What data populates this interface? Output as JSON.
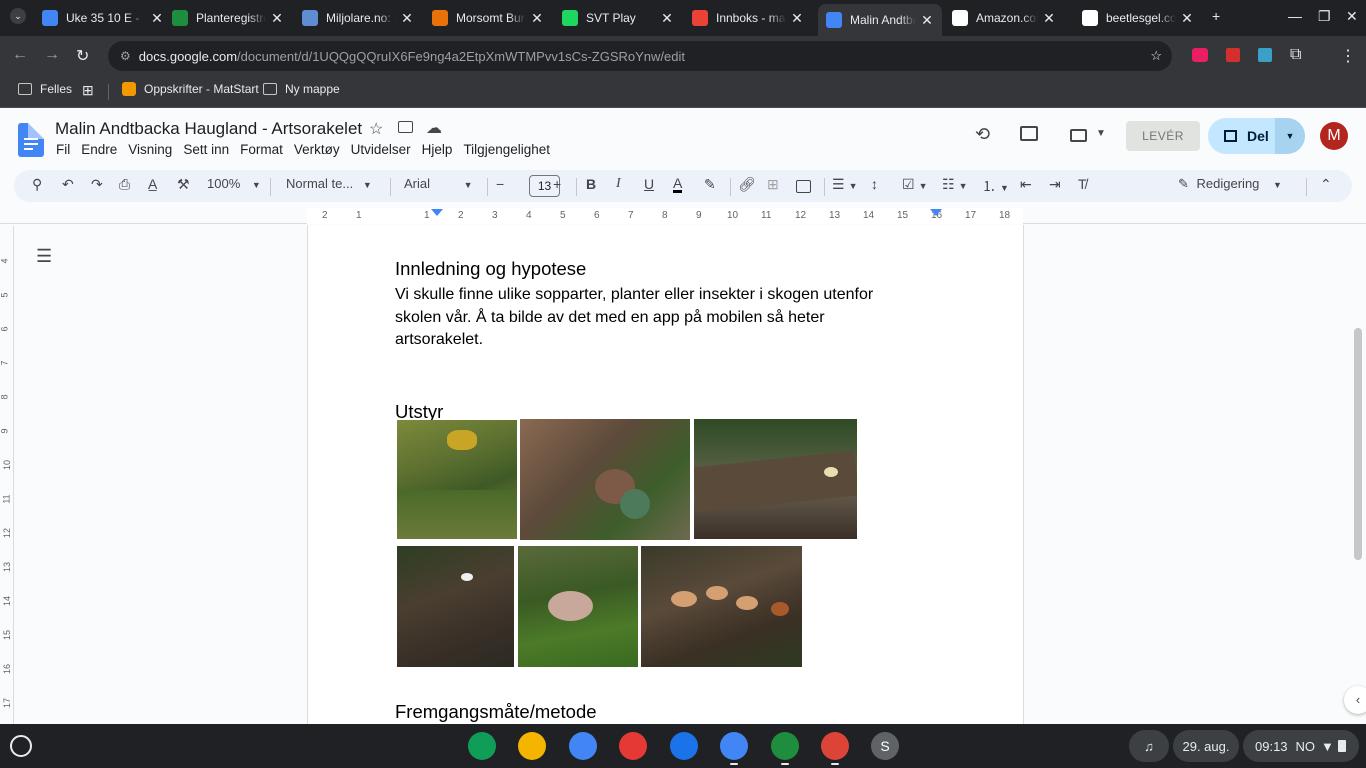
{
  "browser": {
    "tabs": [
      {
        "title": "Uke 35 10 E -",
        "icon": "docs-icon",
        "color": "#4285f4"
      },
      {
        "title": "Planteregistre",
        "icon": "classroom-icon",
        "color": "#1e8e3e"
      },
      {
        "title": "Miljolare.no: F",
        "icon": "globe-icon",
        "color": "#5f8dd3"
      },
      {
        "title": "Morsomt Bur",
        "icon": "site-icon",
        "color": "#e8710a"
      },
      {
        "title": "SVT Play",
        "icon": "play-icon",
        "color": "#1ed760"
      },
      {
        "title": "Innboks - mal",
        "icon": "gmail-icon",
        "color": "#ea4335"
      },
      {
        "title": "Malin Andtba",
        "icon": "docs-icon",
        "color": "#4285f4",
        "active": true
      },
      {
        "title": "Amazon.com",
        "icon": "amazon-icon",
        "color": "#ffffff"
      },
      {
        "title": "beetlesgel.co",
        "icon": "page-icon",
        "color": "#ffffff"
      }
    ],
    "url_domain": "docs.google.com",
    "url_path": "/document/d/1UQQgQQruIX6Fe9ng4a2EtpXmWTMPvv1sCs-ZGSRoYnw/edit",
    "bookmarks": [
      {
        "label": "Felles"
      },
      {
        "label": "Oppskrifter - MatStart"
      },
      {
        "label": "Ny mappe"
      }
    ]
  },
  "docs": {
    "title": "Malin Andtbacka Haugland - Artsorakelet",
    "menu": [
      "Fil",
      "Endre",
      "Visning",
      "Sett inn",
      "Format",
      "Verktøy",
      "Utvidelser",
      "Hjelp",
      "Tilgjengelighet"
    ],
    "lever_label": "LEVÉR",
    "share_label": "Del",
    "avatar_letter": "M",
    "zoom": "100%",
    "style": "Normal te...",
    "font": "Arial",
    "font_size": "13",
    "mode": "Redigering",
    "ruler_numbers": [
      "2",
      "1",
      "1",
      "2",
      "3",
      "4",
      "5",
      "6",
      "7",
      "8",
      "9",
      "10",
      "11",
      "12",
      "13",
      "14",
      "15",
      "16",
      "17",
      "18"
    ],
    "vruler_numbers": [
      "4",
      "5",
      "6",
      "7",
      "8",
      "9",
      "10",
      "11",
      "12",
      "13",
      "14",
      "15",
      "16",
      "17"
    ]
  },
  "document": {
    "heading1": "Innledning og hypotese",
    "paragraph1": "Vi skulle finne ulike sopparter, planter eller insekter i skogen utenfor skolen vår. Å ta bilde av det med en app på mobilen så heter artsorakelet.",
    "heading2": "Utstyr",
    "heading3": "Fremgangsmåte/metode"
  },
  "taskbar": {
    "date": "29. aug.",
    "time": "09:13",
    "locale": "NO",
    "apps": [
      {
        "name": "sheets-app",
        "color": "#0f9d58"
      },
      {
        "name": "slides-app",
        "color": "#f4b400"
      },
      {
        "name": "drive-app",
        "color": "#4285f4"
      },
      {
        "name": "canvas-app",
        "color": "#e53935"
      },
      {
        "name": "news-app",
        "color": "#1a73e8"
      },
      {
        "name": "docs-app",
        "color": "#4285f4"
      },
      {
        "name": "classroom-app",
        "color": "#1e8e3e"
      },
      {
        "name": "chrome-app",
        "color": "#db4437"
      },
      {
        "name": "s-app",
        "color": "#5f6368"
      }
    ],
    "s_letter": "S"
  }
}
